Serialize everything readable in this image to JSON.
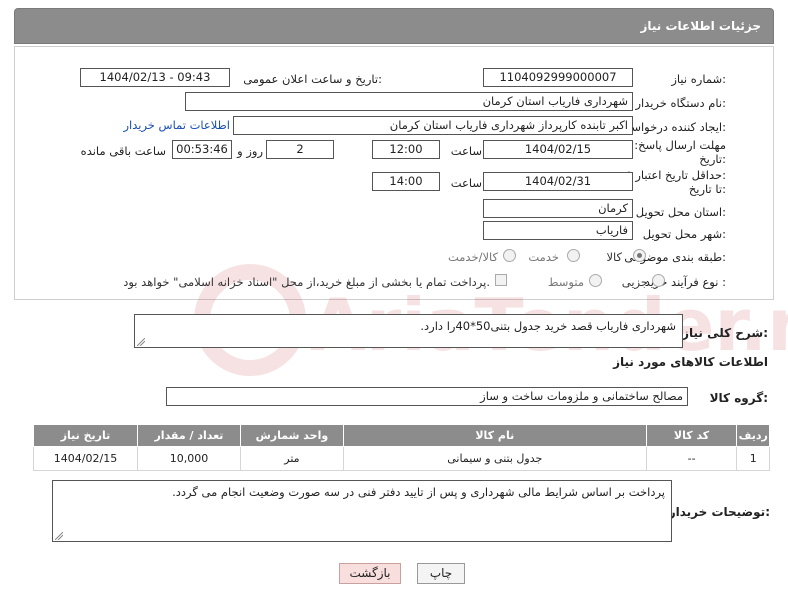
{
  "header": {
    "title": "جزئیات اطلاعات نیاز"
  },
  "fields": {
    "need_number_label": "شماره نیاز:",
    "need_number": "1104092999000007",
    "announce_label": "تاریخ و ساعت اعلان عمومی:",
    "announce_value": "1404/02/13 - 09:43",
    "buyer_org_label": "نام دستگاه خریدار:",
    "buyer_org": "شهرداری فاریاب استان کرمان",
    "creator_label": "ایجاد کننده درخواست:",
    "creator": "اکبر تابنده کارپرداز شهرداری فاریاب استان کرمان",
    "buyer_contact_link": "اطلاعات تماس خریدار",
    "deadline_label_1": "مهلت ارسال پاسخ: تا",
    "deadline_label_2": "تاریخ:",
    "deadline_date": "1404/02/15",
    "time_label": "ساعت",
    "deadline_time": "12:00",
    "days_value": "2",
    "days_label": "روز و",
    "remaining_time": "00:53:46",
    "remaining_label": "ساعت باقی مانده",
    "validity_label_1": "حداقل تاریخ اعتبار قیمت:",
    "validity_label_2": "تا تاریخ:",
    "validity_date": "1404/02/31",
    "validity_time": "14:00",
    "province_label": "استان محل تحویل:",
    "province": "کرمان",
    "city_label": "شهر محل تحویل:",
    "city": "فاریاب",
    "category_label": "طبقه بندی موضوعی:",
    "category_options": [
      "کالا",
      "خدمت",
      "کالا/خدمت"
    ],
    "category_selected": "کالا",
    "process_label": "نوع فرآیند خرید :",
    "process_options": [
      "جزیی",
      "متوسط"
    ],
    "payment_note": "پرداخت تمام یا بخشی از مبلغ خرید،از محل \"اسناد خزانه اسلامی\" خواهد بود."
  },
  "description": {
    "label": "شرح کلی نیاز:",
    "text": "شهرداری فاریاب قصد خرید جدول بتنی50*40را دارد."
  },
  "goods": {
    "section_title": "اطلاعات کالاهای مورد نیاز",
    "group_label": "گروه کالا:",
    "group_value": "مصالح ساختمانی و ملزومات ساخت و ساز",
    "columns": [
      "ردیف",
      "کد کالا",
      "نام کالا",
      "واحد شمارش",
      "تعداد / مقدار",
      "تاریخ نیاز"
    ],
    "rows": [
      {
        "row": "1",
        "code": "--",
        "name": "جدول بتنی و سیمانی",
        "unit": "متر",
        "qty": "10,000",
        "date": "1404/02/15"
      }
    ]
  },
  "buyer_notes": {
    "label": "توضیحات خریدار:",
    "text": "پرداخت بر اساس شرایط مالی شهرداری و پس از تایید دفتر فنی در سه صورت وضعیت انجام می گردد."
  },
  "buttons": {
    "print": "چاپ",
    "back": "بازگشت"
  },
  "watermark": {
    "text": "AriaTender.net",
    "color": "#c0282d"
  }
}
